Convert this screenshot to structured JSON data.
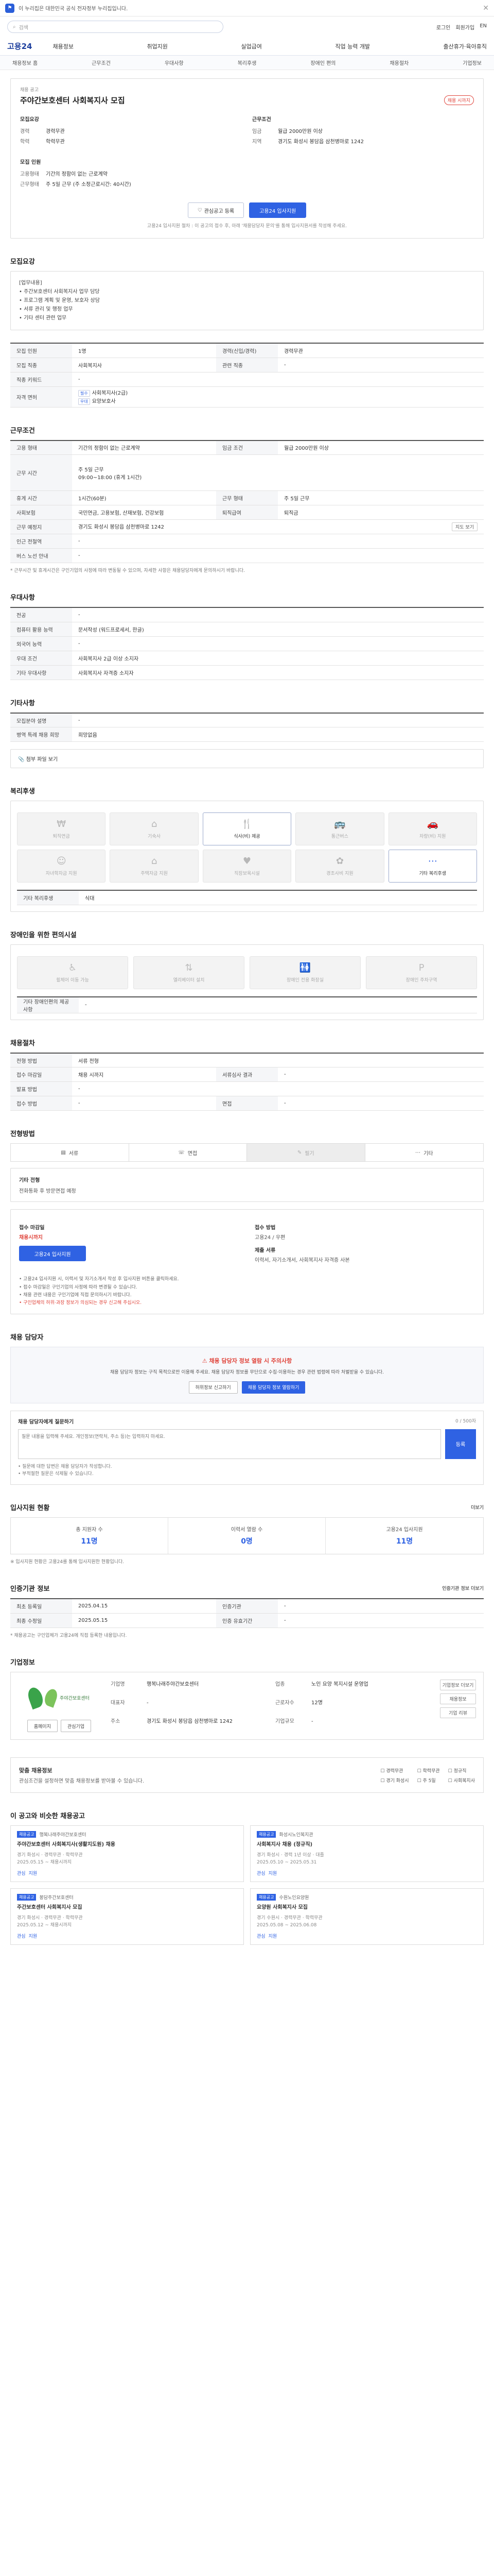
{
  "topbar": {
    "notice": "이 누리집은 대한민국 공식 전자정부 누리집입니다."
  },
  "search": {
    "placeholder": "검색",
    "utils": [
      "로그인",
      "회원가입",
      "EN"
    ]
  },
  "gnb": {
    "brand": "고용24",
    "menu": [
      "채용정보",
      "취업지원",
      "실업급여",
      "직업 능력 개발",
      "출산휴가·육아휴직"
    ]
  },
  "lnb": {
    "items": [
      "채용정보 홈",
      "근무조건",
      "우대사항",
      "복리후생",
      "장애인 편의",
      "채용절차",
      "기업정보"
    ]
  },
  "job": {
    "badge_small": "채용 공고",
    "title": "주야간보호센터 사회복지사 모집",
    "dday": "채용 시까지",
    "company_title": "모집요강",
    "company_rows": [
      {
        "k": "경력",
        "v": "경력무관"
      },
      {
        "k": "학력",
        "v": "학력무관"
      }
    ],
    "cond_title": "근무조건",
    "cond_rows": [
      {
        "k": "임금",
        "v": "월급 2000만원 이상"
      },
      {
        "k": "지역",
        "v": "경기도 화성시 봉담읍 삼천병마로 1242"
      }
    ],
    "person_title": "모집 인원",
    "person_rows": [
      {
        "k": "고용형태",
        "v": "기간의 정함이 없는 근로계약"
      },
      {
        "k": "근무형태",
        "v": "주 5일 근무 (주 소정근로시간: 40시간)"
      }
    ],
    "scrap_label": "관심공고 등록",
    "apply_label": "고용24 입사지원",
    "apply_note": "고용24 입사지원 절차 : 이 공고의 접수 후, 아래 '채용담당자 문의'를 통해 입사지원서를 작성해 주세요."
  },
  "detail": {
    "title": "모집요강",
    "lines": [
      "[업무내용]",
      "• 주간보호센터 사회복지사 업무 담당",
      "• 프로그램 계획 및 운영, 보호자 상담",
      "• 서류 관리 및 행정 업무",
      "• 기타 센터 관련 업무"
    ]
  },
  "recruit_table": {
    "rows": [
      {
        "k1": "모집 인원",
        "v1": "1명",
        "k2": "경력(신입/경력)",
        "v2": "경력무관"
      },
      {
        "k1": "모집 직종",
        "v1": "사회복지사",
        "k2": "관련 직종",
        "v2": "-"
      },
      {
        "k1": "직종 키워드",
        "v1": "-",
        "k2": "",
        "v2": ""
      },
      {
        "k1": "경력",
        "v1": "경력무관",
        "k2": "학력",
        "v2": "학력무관"
      }
    ],
    "cert_label": "자격 면허",
    "certs": [
      "사회복지사(2급)",
      "요양보호사"
    ]
  },
  "work_table": {
    "title": "근무조건",
    "rows": [
      {
        "k1": "고용 형태",
        "v1": "기간의 정함이 없는 근로계약",
        "k2": "임금 조건",
        "v2": "월급 2000만원 이상"
      },
      {
        "k1": "",
        "v1": "주 5일 근무",
        "k2": "",
        "v2": ""
      },
      {
        "k1": "근무 시간",
        "v1": "09:00~18:00 (휴게 1시간)",
        "k2": "",
        "v2": ""
      },
      {
        "k1": "휴게 시간",
        "v1": "1시간(60분)",
        "k2": "근무 형태",
        "v2": "주 5일 근무"
      },
      {
        "k1": "사회보험",
        "v1": "국민연금, 고용보험, 산재보험, 건강보험",
        "k2": "퇴직급여",
        "v2": "퇴직금"
      },
      {
        "k1": "근무 예정지",
        "v1": "경기도 화성시 봉담읍 삼천병마로 1242",
        "k2": "",
        "v2": ""
      },
      {
        "k1": "인근 전철역",
        "v1": "-",
        "k2": "",
        "v2": ""
      },
      {
        "k1": "버스 노선 안내",
        "v1": "-",
        "k2": "",
        "v2": ""
      }
    ],
    "map_button": "지도 보기",
    "note": "* 근무시간 및 휴게시간은 구인기업의 사정에 따라 변동될 수 있으며, 자세한 사항은 채용담당자에게 문의하시기 바랍니다."
  },
  "pref_table": {
    "title": "우대사항",
    "rows": [
      {
        "k": "전공",
        "v": "-"
      },
      {
        "k": "컴퓨터 활용 능력",
        "v": "문서작성 (워드프로세서, 한글)"
      },
      {
        "k": "외국어 능력",
        "v": "-"
      },
      {
        "k": "우대 조건",
        "v": "사회복지사 2급 이상 소지자"
      },
      {
        "k": "기타 우대사항",
        "v": "사회복지사 자격증 소지자"
      }
    ]
  },
  "etc_table": {
    "title": "기타사항",
    "rows": [
      {
        "k": "모집분야 설명",
        "v": "-"
      },
      {
        "k": "병역 특례 채용 희망",
        "v": "희망없음"
      }
    ],
    "attach_label": "첨부 파일 보기"
  },
  "welfare": {
    "title": "복리후생",
    "items": [
      {
        "icon": "retirement-icon",
        "label": "퇴직연금",
        "on": false
      },
      {
        "icon": "house-icon",
        "label": "기숙사",
        "on": false
      },
      {
        "icon": "meal-icon",
        "label": "식사(비) 제공",
        "on": true
      },
      {
        "icon": "bus-icon",
        "label": "통근버스",
        "on": false
      },
      {
        "icon": "car-icon",
        "label": "차량(비) 지원",
        "on": false
      },
      {
        "icon": "child-icon",
        "label": "자녀학자금 지원",
        "on": false
      },
      {
        "icon": "house-icon",
        "label": "주택자금 지원",
        "on": false
      },
      {
        "icon": "baby-icon",
        "label": "직장보육시설",
        "on": false
      },
      {
        "icon": "party-icon",
        "label": "경조사비 지원",
        "on": false
      },
      {
        "icon": "etc-icon",
        "label": "기타 복리후생",
        "on": true
      }
    ],
    "etc_title": "기타 복리후생",
    "etc_value": "식대"
  },
  "access": {
    "title": "장애인을 위한 편의시설",
    "items": [
      {
        "icon": "wheelchair-icon",
        "label": "휠체어 이동 가능"
      },
      {
        "icon": "elevator-icon",
        "label": "엘리베이터 설치"
      },
      {
        "icon": "toilet-icon",
        "label": "장애인 전용 화장실"
      },
      {
        "icon": "parking-icon",
        "label": "장애인 주차구역"
      }
    ],
    "etc_title": "기타 장애인편의 제공사항",
    "etc_value": "-"
  },
  "process": {
    "title": "채용절차",
    "rows": [
      {
        "k1": "전형 방법",
        "v1": "서류 전형",
        "k2": "",
        "v2": ""
      },
      {
        "k1": "접수 마감일",
        "v1": "채용 시까지",
        "k2": "서류심사 결과",
        "v2": "-"
      },
      {
        "k1": "발표 방법",
        "v1": "-",
        "k2": "",
        "v2": ""
      },
      {
        "k1": "접수 방법",
        "v1": "-",
        "k2": "면접",
        "v2": "-"
      }
    ]
  },
  "apply_method": {
    "title": "전형방법",
    "items": [
      {
        "icon": "document-icon",
        "label": "서류",
        "off": false
      },
      {
        "icon": "interview-icon",
        "label": "면접",
        "off": false
      },
      {
        "icon": "test-icon",
        "label": "필기",
        "off": true
      },
      {
        "icon": "etc-icon",
        "label": "기타",
        "off": false
      }
    ],
    "other_title": "기타 전형",
    "other_value": "전화통화 후 방문면접 예정"
  },
  "apply_info": {
    "deadline_label": "접수 마감일",
    "deadline_value": "채용시까지",
    "method_label": "접수 방법",
    "method_value": "고용24 / 우편",
    "docs_label": "제출 서류",
    "docs_value": "이력서, 자기소개서, 사회복지사 자격증 사본",
    "button": "고용24 입사지원",
    "notes": [
      "• 고용24 입사지원 시, 이력서 및 자기소개서 작성 후 입사지원 버튼을 클릭하세요.",
      "• 접수 마감일은 구인기업의 사정에 따라 변경될 수 있습니다.",
      "• 채용 관련 내용은 구인기업에 직접 문의하시기 바랍니다."
    ],
    "warn": "• 구인업체의 허위·과장 정보가 의심되는 경우 신고해 주십시오."
  },
  "contact": {
    "title": "채용 담당자",
    "alert": "채용 담당자 정보 열람 시 주의사항",
    "desc": "채용 담당자 정보는 구직 목적으로만 이용해 주세요. 채용 담당자 정보를 무단으로 수집·이용하는 경우 관련 법령에 따라 처벌받을 수 있습니다.",
    "btn_report": "허위정보 신고하기",
    "btn_view": "채용 담당자 정보 열람하기"
  },
  "qna": {
    "title": "채용 담당자에게 질문하기",
    "count": "0 / 500자",
    "placeholder": "질문 내용을 입력해 주세요. 개인정보(연락처, 주소 등)는 입력하지 마세요.",
    "submit": "등록",
    "notes": [
      "• 질문에 대한 답변은 채용 담당자가 작성합니다.",
      "• 부적절한 질문은 삭제될 수 있습니다."
    ]
  },
  "apply_stats": {
    "title": "입사지원 현황",
    "more": "더보기",
    "items": [
      {
        "label": "총 지원자 수",
        "value": "11명"
      },
      {
        "label": "이력서 열람 수",
        "value": "0명"
      },
      {
        "label": "고용24 입사지원",
        "value": "11명"
      }
    ],
    "note": "※ 입사지원 현황은 고용24를 통해 입사지원한 현황입니다."
  },
  "info_table": {
    "title": "인증기관 정보",
    "right": "인증기관 정보 더보기",
    "rows": [
      {
        "k1": "최초 등록일",
        "v1": "2025.04.15",
        "k2": "인증기관",
        "v2": "-"
      },
      {
        "k1": "최종 수정일",
        "v1": "2025.05.15",
        "k2": "인증 유효기간",
        "v2": "-"
      }
    ],
    "note": "* 채용공고는 구인업체가 고용24에 직접 등록한 내용입니다."
  },
  "company": {
    "title": "기업정보",
    "logo_text": "주야간보호센터",
    "btn_home": "홈페이지",
    "btn_fav": "관심기업",
    "rows": [
      {
        "k": "기업명",
        "v": "행복나래주야간보호센터"
      },
      {
        "k": "업종",
        "v": "노인 요양 복지시설 운영업"
      },
      {
        "k": "대표자",
        "v": "-"
      },
      {
        "k": "근로자수",
        "v": "12명"
      },
      {
        "k": "주소",
        "v": "경기도 화성시 봉담읍 삼천병마로 1242"
      },
      {
        "k": "기업규모",
        "v": "-"
      }
    ],
    "side": [
      "기업정보 더보기",
      "채용정보",
      "기업 리뷰"
    ]
  },
  "pref_box": {
    "t1": "맞춤 채용정보",
    "t2": "관심조건을 설정하면 맞춤 채용정보를 받아볼 수 있습니다.",
    "opts": [
      "경력무관",
      "학력무관",
      "정규직",
      "경기 화성시",
      "주 5일",
      "사회복지사"
    ]
  },
  "recommend": {
    "title": "이 공고와 비슷한 채용공고",
    "cards": [
      {
        "badge": "채용공고",
        "org": "행복나래주야간보호센터",
        "title": "주야간보호센터 사회복지사(생활지도원) 채용",
        "meta": "경기 화성시 · 경력무관 · 학력무관",
        "date": "2025.05.15 ~ 채용시까지",
        "foot": [
          "관심",
          "지원"
        ]
      },
      {
        "badge": "채용공고",
        "org": "화성시노인복지관",
        "title": "사회복지사 채용 (정규직)",
        "meta": "경기 화성시 · 경력 1년 이상 · 대졸",
        "date": "2025.05.10 ~ 2025.05.31",
        "foot": [
          "관심",
          "지원"
        ]
      },
      {
        "badge": "채용공고",
        "org": "봉담주간보호센터",
        "title": "주간보호센터 사회복지사 모집",
        "meta": "경기 화성시 · 경력무관 · 학력무관",
        "date": "2025.05.12 ~ 채용시까지",
        "foot": [
          "관심",
          "지원"
        ]
      },
      {
        "badge": "채용공고",
        "org": "수원노인요양원",
        "title": "요양원 사회복지사 모집",
        "meta": "경기 수원시 · 경력무관 · 학력무관",
        "date": "2025.05.08 ~ 2025.06.08",
        "foot": [
          "관심",
          "지원"
        ]
      }
    ]
  }
}
